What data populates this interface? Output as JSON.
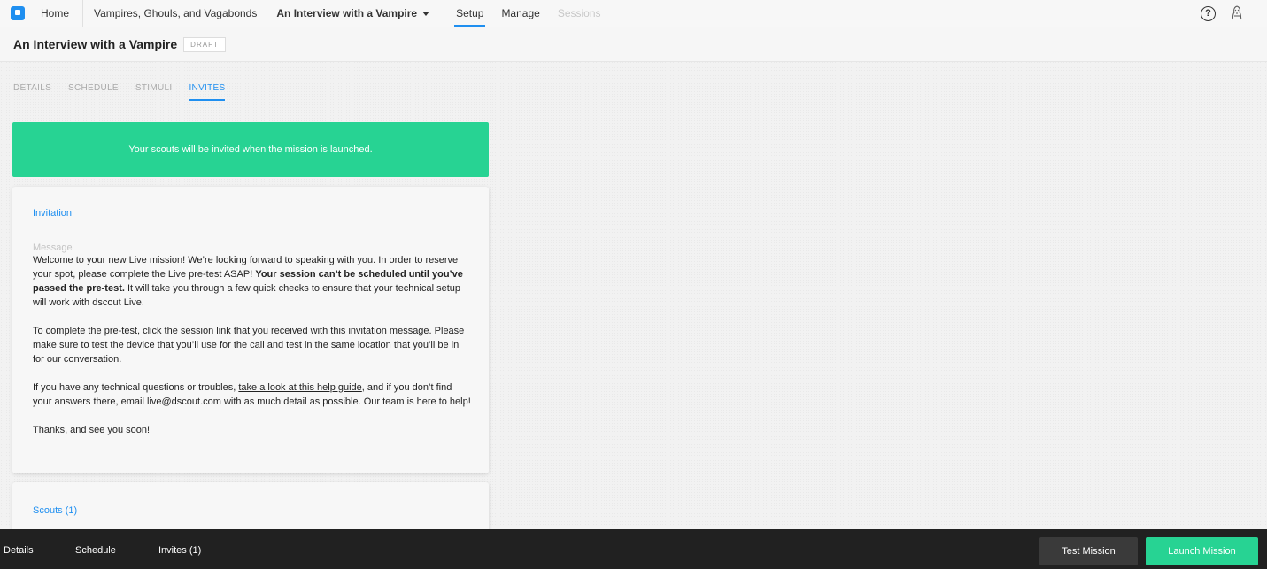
{
  "nav": {
    "home": "Home",
    "project": "Vampires, Ghouls, and Vagabonds",
    "mission": "An Interview with a Vampire",
    "setup": "Setup",
    "manage": "Manage",
    "sessions": "Sessions",
    "help_glyph": "?"
  },
  "header": {
    "title": "An Interview with a Vampire",
    "badge": "DRAFT"
  },
  "tabs": [
    "DETAILS",
    "SCHEDULE",
    "STIMULI",
    "INVITES"
  ],
  "banner": "Your scouts will be invited when the mission is launched.",
  "invitation": {
    "title": "Invitation",
    "message_label": "Message",
    "p1_a": "Welcome to your new Live mission! We’re looking forward to speaking with you. In order to reserve your spot, please complete the Live pre-test ASAP! ",
    "p1_b": "Your session can’t be scheduled until you’ve passed the pre-test.",
    "p1_c": " It will take you through a few quick checks to ensure that your technical setup will work with dscout Live.",
    "p2": "To complete the pre-test, click the session link that you received with this invitation message. Please make sure to test the device that you’ll use for the call and test in the same location that you’ll be in for our conversation.",
    "p3_a": "If you have any technical questions or troubles, ",
    "p3_link": "take a look at this help guide",
    "p3_b": ", and if you don’t find your answers there, email live@dscout.com with as much detail as possible. Our team is here to help!",
    "p4": "Thanks, and see you soon!"
  },
  "scouts": {
    "title": "Scouts (1)"
  },
  "bottom": {
    "details": "Details",
    "schedule": "Schedule",
    "invites": "Invites (1)",
    "test": "Test Mission",
    "launch": "Launch Mission"
  },
  "colors": {
    "accent": "#1f8ff0",
    "success": "#27d393",
    "bottom_bar": "#212121"
  },
  "icons": [
    "dscout-logo-icon",
    "caret-down-icon",
    "help-icon",
    "avatar-icon"
  ]
}
